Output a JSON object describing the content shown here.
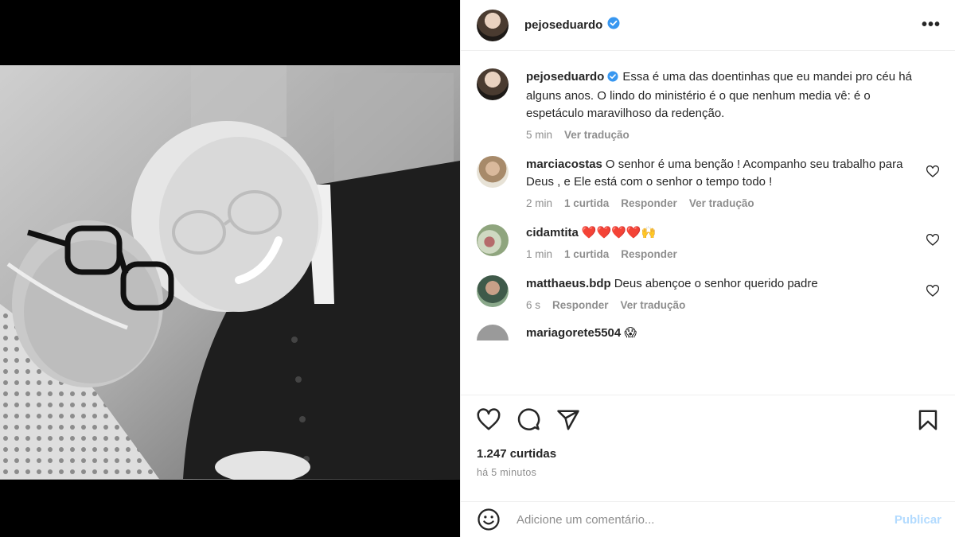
{
  "post": {
    "username": "pejoseduardo",
    "more_label": "•••"
  },
  "caption": {
    "username": "pejoseduardo",
    "text": "Essa é uma das doentinhas que eu mandei pro céu há alguns anos. O lindo do ministério é o que nenhum media vê: é o espetáculo maravilhoso da redenção.",
    "time": "5 min",
    "translate": "Ver tradução"
  },
  "comments": [
    {
      "username": "marciacostas",
      "text": "O senhor é uma benção ! Acompanho seu trabalho para Deus , e Ele está com o senhor o tempo todo !",
      "time": "2 min",
      "likes": "1 curtida",
      "reply": "Responder",
      "translate": "Ver tradução"
    },
    {
      "username": "cidamtita",
      "text": "❤️❤️❤️❤️🙌",
      "time": "1 min",
      "likes": "1 curtida",
      "reply": "Responder"
    },
    {
      "username": "matthaeus.bdp",
      "text": "Deus abençoe o senhor querido padre",
      "time": "6 s",
      "reply": "Responder",
      "translate": "Ver tradução"
    },
    {
      "username": "mariagorete5504",
      "text": "😱"
    }
  ],
  "footer": {
    "likes": "1.247 curtidas",
    "time_ago": "há 5 minutos",
    "comment_placeholder": "Adicione um comentário...",
    "publish": "Publicar"
  },
  "colors": {
    "verified": "#3897f0",
    "heart_emoji": "#ed4956",
    "publish_disabled": "#b3dbff"
  }
}
